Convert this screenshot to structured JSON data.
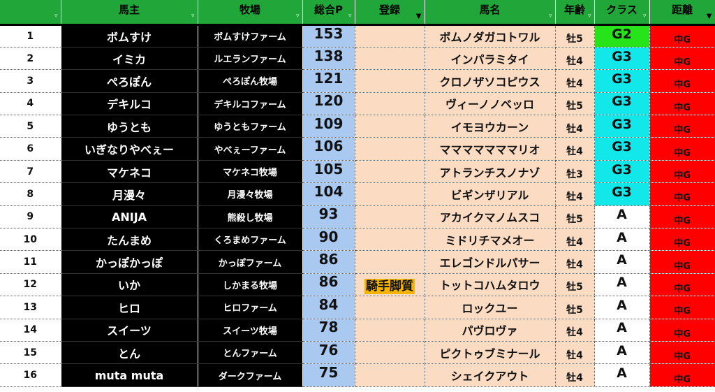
{
  "columns": {
    "owner": "馬主",
    "farm": "牧場",
    "points": "総合P",
    "registration": "登録",
    "horse": "馬名",
    "age": "年齢",
    "class": "クラス",
    "distance": "距離"
  },
  "colors": {
    "header": "#21a63a",
    "owner_bg": "#000000",
    "points_bg": "#aac9f1",
    "peach_bg": "#fbdcc3",
    "g2": "#26e31a",
    "g3": "#12e8ea",
    "distance": "#ff0000",
    "badge": "#f5b400"
  },
  "rows": [
    {
      "num": "1",
      "owner": "ボムすけ",
      "farm": "ボムすけファーム",
      "points": "153",
      "registration": "",
      "horse": "ボムノダガコトワル",
      "age": "牡5",
      "class": "G2",
      "distance": "中G"
    },
    {
      "num": "2",
      "owner": "イミカ",
      "farm": "ルエランファーム",
      "points": "138",
      "registration": "",
      "horse": "インパラミタイ",
      "age": "牡4",
      "class": "G3",
      "distance": "中G"
    },
    {
      "num": "3",
      "owner": "ぺろぽん",
      "farm": "ぺろぽん牧場",
      "points": "121",
      "registration": "",
      "horse": "クロノザソコピウス",
      "age": "牡4",
      "class": "G3",
      "distance": "中G"
    },
    {
      "num": "4",
      "owner": "デキルコ",
      "farm": "デキルコファーム",
      "points": "120",
      "registration": "",
      "horse": "ヴィーノノベッロ",
      "age": "牡5",
      "class": "G3",
      "distance": "中G"
    },
    {
      "num": "5",
      "owner": "ゆうとも",
      "farm": "ゆうともファーム",
      "points": "109",
      "registration": "",
      "horse": "イモヨウカーン",
      "age": "牡4",
      "class": "G3",
      "distance": "中G"
    },
    {
      "num": "6",
      "owner": "いぎなりやべぇー",
      "farm": "やべぇーファーム",
      "points": "106",
      "registration": "",
      "horse": "マママママママリオ",
      "age": "牡4",
      "class": "G3",
      "distance": "中G"
    },
    {
      "num": "7",
      "owner": "マケネコ",
      "farm": "マケネコ牧場",
      "points": "105",
      "registration": "",
      "horse": "アトランチスノナゾ",
      "age": "牡3",
      "class": "G3",
      "distance": "中G"
    },
    {
      "num": "8",
      "owner": "月漫々",
      "farm": "月漫々牧場",
      "points": "104",
      "registration": "",
      "horse": "ビギンザリアル",
      "age": "牡4",
      "class": "G3",
      "distance": "中G"
    },
    {
      "num": "9",
      "owner": "ANIJA",
      "farm": "熊殺し牧場",
      "points": "93",
      "registration": "",
      "horse": "アカイクマノムスコ",
      "age": "牡5",
      "class": "A",
      "distance": "中G"
    },
    {
      "num": "10",
      "owner": "たんまめ",
      "farm": "くろまめファーム",
      "points": "90",
      "registration": "",
      "horse": "ミドリチマメオー",
      "age": "牡4",
      "class": "A",
      "distance": "中G"
    },
    {
      "num": "11",
      "owner": "かっぽかっぽ",
      "farm": "かっぽファーム",
      "points": "86",
      "registration": "",
      "horse": "エレゴンドルパサー",
      "age": "牡4",
      "class": "A",
      "distance": "中G"
    },
    {
      "num": "12",
      "owner": "いか",
      "farm": "しかまる牧場",
      "points": "86",
      "registration": "騎手脚質",
      "horse": "トットコハムタロウ",
      "age": "牡5",
      "class": "A",
      "distance": "中G"
    },
    {
      "num": "13",
      "owner": "ヒロ",
      "farm": "ヒロファーム",
      "points": "84",
      "registration": "",
      "horse": "ロックユー",
      "age": "牡5",
      "class": "A",
      "distance": "中G"
    },
    {
      "num": "14",
      "owner": "スイーツ",
      "farm": "スイーツ牧場",
      "points": "78",
      "registration": "",
      "horse": "パヴロヴァ",
      "age": "牡4",
      "class": "A",
      "distance": "中G"
    },
    {
      "num": "15",
      "owner": "とん",
      "farm": "とんファーム",
      "points": "76",
      "registration": "",
      "horse": "ピクトゥブミナール",
      "age": "牡4",
      "class": "A",
      "distance": "中G"
    },
    {
      "num": "16",
      "owner": "muta muta",
      "farm": "ダークファーム",
      "points": "75",
      "registration": "",
      "horse": "シェイクアウト",
      "age": "牡4",
      "class": "A",
      "distance": "中G"
    }
  ]
}
